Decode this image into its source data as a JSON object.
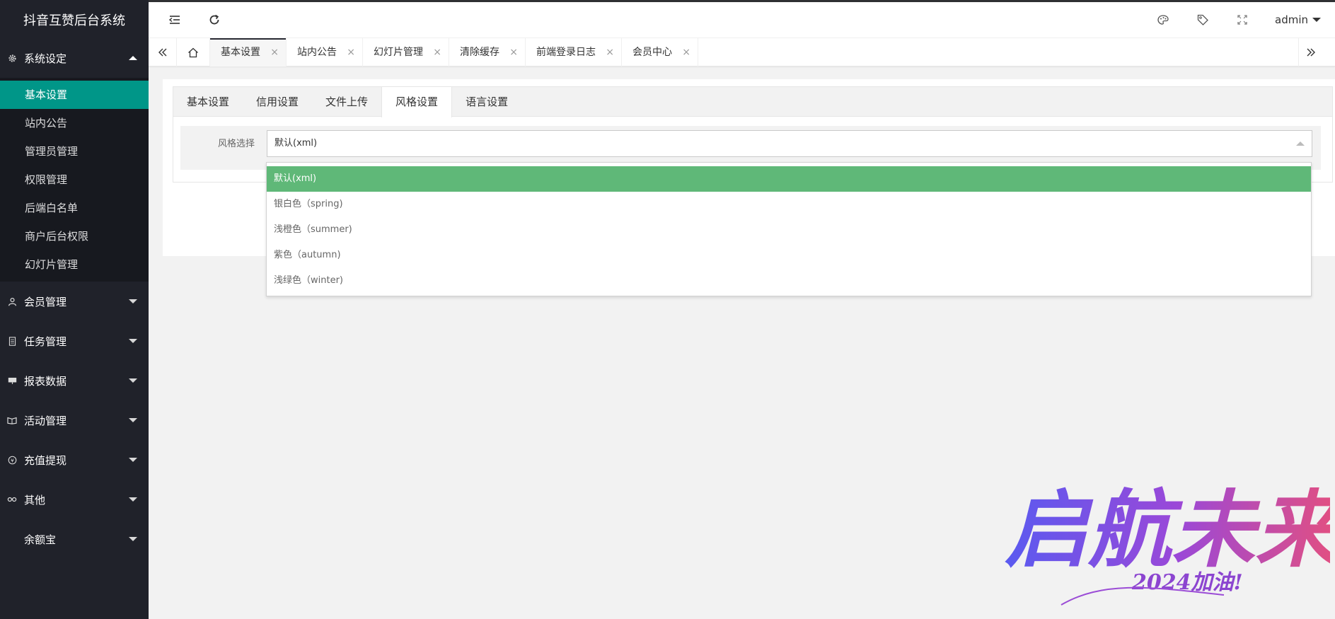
{
  "app": {
    "title": "抖音互赞后台系统"
  },
  "sidebar": {
    "groups": [
      {
        "label": "系统设定",
        "icon": "gear-icon",
        "expanded": true,
        "items": [
          {
            "label": "基本设置",
            "active": true
          },
          {
            "label": "站内公告"
          },
          {
            "label": "管理员管理"
          },
          {
            "label": "权限管理"
          },
          {
            "label": "后端白名单"
          },
          {
            "label": "商户后台权限"
          },
          {
            "label": "幻灯片管理"
          }
        ]
      },
      {
        "label": "会员管理",
        "icon": "user-icon"
      },
      {
        "label": "任务管理",
        "icon": "task-icon"
      },
      {
        "label": "报表数据",
        "icon": "report-icon"
      },
      {
        "label": "活动管理",
        "icon": "activity-icon"
      },
      {
        "label": "充值提现",
        "icon": "yen-icon"
      },
      {
        "label": "其他",
        "icon": "link-icon"
      },
      {
        "label": "余额宝",
        "icon": ""
      }
    ]
  },
  "header": {
    "user": "admin"
  },
  "pagetabs": {
    "items": [
      {
        "label": "基本设置",
        "active": true
      },
      {
        "label": "站内公告"
      },
      {
        "label": "幻灯片管理"
      },
      {
        "label": "清除缓存"
      },
      {
        "label": "前端登录日志"
      },
      {
        "label": "会员中心"
      }
    ],
    "close_glyph": "×"
  },
  "settings": {
    "tabs": [
      {
        "label": "基本设置"
      },
      {
        "label": "信用设置"
      },
      {
        "label": "文件上传"
      },
      {
        "label": "风格设置",
        "active": true
      },
      {
        "label": "语言设置"
      }
    ],
    "form": {
      "label": "风格选择",
      "selected": "默认(xml)",
      "options": [
        "默认(xml)",
        "银白色（spring)",
        "浅橙色（summer)",
        "紫色（autumn)",
        "浅绿色（winter)"
      ]
    }
  },
  "watermark": {
    "main": "启航未来",
    "sub": "2024加油!"
  },
  "colors": {
    "sidebar_bg": "#20222a",
    "active_item": "#009688",
    "option_selected": "#5fb878"
  }
}
